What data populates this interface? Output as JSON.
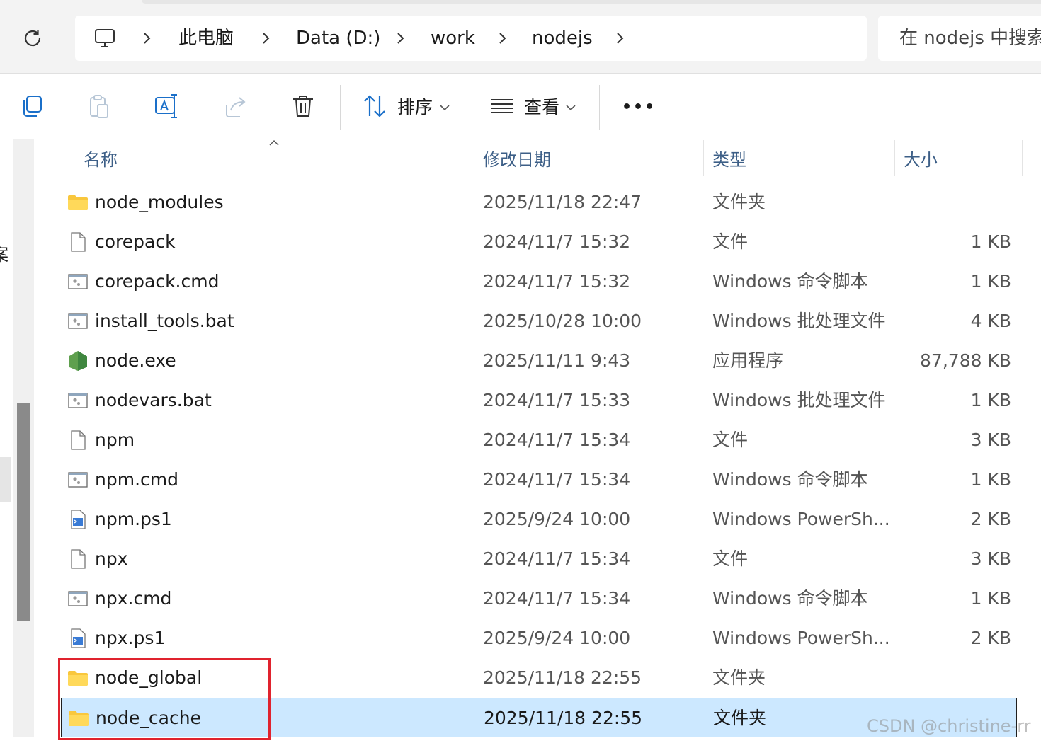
{
  "breadcrumb": {
    "items": [
      "此电脑",
      "Data (D:)",
      "work",
      "nodejs"
    ]
  },
  "search": {
    "placeholder": "在 nodejs 中搜索"
  },
  "toolbar": {
    "sort_label": "排序",
    "view_label": "查看",
    "more_label": "•••"
  },
  "nav": {
    "partial_char": "案"
  },
  "columns": {
    "name": "名称",
    "date": "修改日期",
    "type": "类型",
    "size": "大小"
  },
  "files": [
    {
      "name": "node_modules",
      "date": "2025/11/18 22:47",
      "type": "文件夹",
      "size": "",
      "icon": "folder-icon"
    },
    {
      "name": "corepack",
      "date": "2024/11/7 15:32",
      "type": "文件",
      "size": "1 KB",
      "icon": "file-icon"
    },
    {
      "name": "corepack.cmd",
      "date": "2024/11/7 15:32",
      "type": "Windows 命令脚本",
      "size": "1 KB",
      "icon": "script-file-icon"
    },
    {
      "name": "install_tools.bat",
      "date": "2025/10/28 10:00",
      "type": "Windows 批处理文件",
      "size": "4 KB",
      "icon": "script-file-icon"
    },
    {
      "name": "node.exe",
      "date": "2025/11/11 9:43",
      "type": "应用程序",
      "size": "87,788 KB",
      "icon": "nodejs-hexagon-icon"
    },
    {
      "name": "nodevars.bat",
      "date": "2024/11/7 15:33",
      "type": "Windows 批处理文件",
      "size": "1 KB",
      "icon": "script-file-icon"
    },
    {
      "name": "npm",
      "date": "2024/11/7 15:34",
      "type": "文件",
      "size": "3 KB",
      "icon": "file-icon"
    },
    {
      "name": "npm.cmd",
      "date": "2024/11/7 15:34",
      "type": "Windows 命令脚本",
      "size": "1 KB",
      "icon": "script-file-icon"
    },
    {
      "name": "npm.ps1",
      "date": "2025/9/24 10:00",
      "type": "Windows PowerSh...",
      "size": "2 KB",
      "icon": "powershell-file-icon"
    },
    {
      "name": "npx",
      "date": "2024/11/7 15:34",
      "type": "文件",
      "size": "3 KB",
      "icon": "file-icon"
    },
    {
      "name": "npx.cmd",
      "date": "2024/11/7 15:34",
      "type": "Windows 命令脚本",
      "size": "1 KB",
      "icon": "script-file-icon"
    },
    {
      "name": "npx.ps1",
      "date": "2025/9/24 10:00",
      "type": "Windows PowerSh...",
      "size": "2 KB",
      "icon": "powershell-file-icon"
    },
    {
      "name": "node_global",
      "date": "2025/11/18 22:55",
      "type": "文件夹",
      "size": "",
      "icon": "folder-icon"
    },
    {
      "name": "node_cache",
      "date": "2025/11/18 22:55",
      "type": "文件夹",
      "size": "",
      "icon": "folder-icon",
      "selected": true
    }
  ],
  "watermark": "CSDN @christine-rr",
  "colors": {
    "selection": "#cce8ff",
    "highlight_border": "#e0232e",
    "header_text": "#3d5f87"
  }
}
